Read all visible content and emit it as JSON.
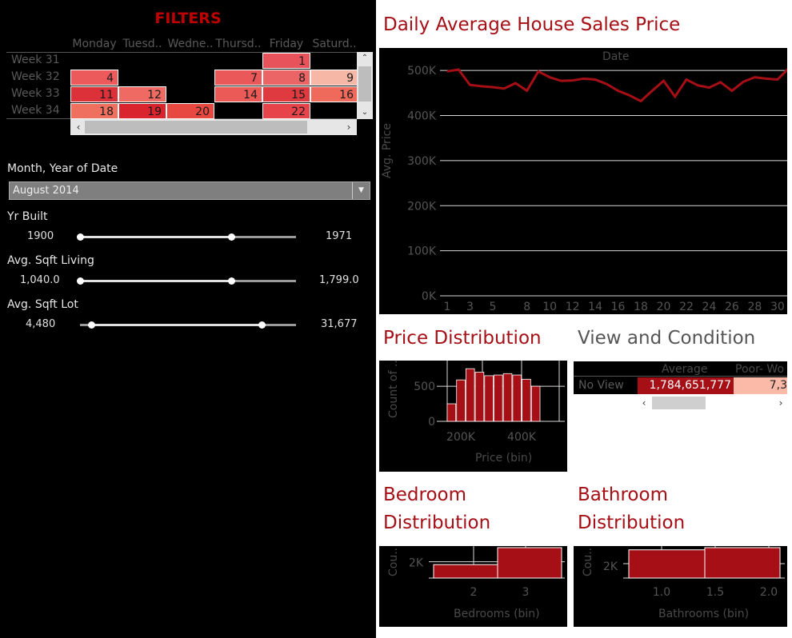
{
  "filters": {
    "title": "FILTERS",
    "calendar": {
      "days": [
        "Monday",
        "Tuesd..",
        "Wedne..",
        "Thursd..",
        "Friday",
        "Saturd.."
      ],
      "weeks": [
        "Week 31",
        "Week 32",
        "Week 33",
        "Week 34"
      ],
      "cells": [
        {
          "week": 0,
          "day": 4,
          "label": "1",
          "color": "#e8525a"
        },
        {
          "week": 1,
          "day": 0,
          "label": "4",
          "color": "#ec5a5c"
        },
        {
          "week": 1,
          "day": 3,
          "label": "7",
          "color": "#ea5859"
        },
        {
          "week": 1,
          "day": 4,
          "label": "8",
          "color": "#ec6566"
        },
        {
          "week": 1,
          "day": 5,
          "label": "9",
          "color": "#f7b7a7"
        },
        {
          "week": 2,
          "day": 0,
          "label": "11",
          "color": "#dc3139"
        },
        {
          "week": 2,
          "day": 1,
          "label": "12",
          "color": "#ee6a63"
        },
        {
          "week": 2,
          "day": 3,
          "label": "14",
          "color": "#ec5a58"
        },
        {
          "week": 2,
          "day": 4,
          "label": "15",
          "color": "#e03a41"
        },
        {
          "week": 2,
          "day": 5,
          "label": "16",
          "color": "#f06a5c"
        },
        {
          "week": 3,
          "day": 0,
          "label": "18",
          "color": "#f0705f"
        },
        {
          "week": 3,
          "day": 1,
          "label": "19",
          "color": "#d9242d"
        },
        {
          "week": 3,
          "day": 2,
          "label": "20",
          "color": "#e7483f"
        },
        {
          "week": 3,
          "day": 4,
          "label": "22",
          "color": "#e7434a"
        }
      ]
    },
    "month_year": {
      "label": "Month, Year of Date",
      "value": "August 2014"
    },
    "yr_built": {
      "label": "Yr Built",
      "min": "1900",
      "max": "1971",
      "range": [
        0,
        0.7
      ]
    },
    "sqft_living": {
      "label": "Avg. Sqft Living",
      "min": "1,040.0",
      "max": "1,799.0",
      "range": [
        0,
        0.7
      ]
    },
    "sqft_lot": {
      "label": "Avg. Sqft Lot",
      "min": "4,480",
      "max": "31,677",
      "range": [
        0.05,
        0.84
      ]
    }
  },
  "daily": {
    "title": "Daily Average House Sales Price",
    "xaxis_title": "Date",
    "yaxis_title": "Avg. Price",
    "chart_data": {
      "type": "line",
      "title": "Daily Average House Sales Price",
      "xlabel": "Date",
      "ylabel": "Avg. Price",
      "x": [
        1,
        2,
        3,
        4,
        5,
        6,
        7,
        8,
        9,
        10,
        11,
        12,
        13,
        14,
        15,
        16,
        17,
        18,
        19,
        20,
        21,
        22,
        23,
        24,
        25,
        26,
        27,
        28,
        29,
        30,
        31
      ],
      "values": [
        498000,
        502000,
        468000,
        465000,
        463000,
        460000,
        472000,
        455000,
        498000,
        485000,
        477000,
        478000,
        482000,
        480000,
        470000,
        455000,
        445000,
        432000,
        455000,
        477000,
        442000,
        480000,
        467000,
        462000,
        474000,
        455000,
        475000,
        485000,
        482000,
        480000,
        505000
      ],
      "ylim": [
        0,
        550000
      ],
      "yticks": [
        "0K",
        "100K",
        "200K",
        "300K",
        "400K",
        "500K"
      ],
      "xticks": [
        "1",
        "3",
        "5",
        "8",
        "10",
        "12",
        "14",
        "16",
        "18",
        "20",
        "22",
        "24",
        "26",
        "28",
        "30"
      ],
      "color": "#a50f15"
    }
  },
  "price_dist": {
    "title": "Price Distribution",
    "xlabel": "Price (bin)",
    "ylabel": "Count of ..",
    "chart_data": {
      "type": "bar",
      "xlabel": "Price (bin)",
      "ylabel": "Count of ..",
      "values": [
        250,
        590,
        750,
        700,
        650,
        660,
        680,
        660,
        600,
        500
      ],
      "ylim": [
        0,
        820
      ],
      "yticks": [
        "0",
        "500"
      ],
      "xticks": [
        "200K",
        "400K"
      ],
      "color": "#a50f15"
    }
  },
  "view_condition": {
    "title": "View and Condition",
    "col_headers": [
      "Average",
      "Poor- Wo"
    ],
    "row_label": "No View",
    "values": [
      "1,784,651,777",
      "7,3"
    ],
    "colors": [
      "#a50f15",
      "#fbb9a7"
    ]
  },
  "bedroom": {
    "title_line1": "Bedroom",
    "title_line2": "Distribution",
    "xlabel": "Bedrooms (bin)",
    "ylabel": "Cou..",
    "chart_data": {
      "type": "bar",
      "xlabel": "Bedrooms (bin)",
      "ylabel": "Cou..",
      "categories": [
        "2",
        "3"
      ],
      "values": [
        1500,
        3400
      ],
      "yticks": [
        "2K"
      ],
      "color": "#a50f15"
    }
  },
  "bathroom": {
    "title_line1": "Bathroom",
    "title_line2": "Distribution",
    "xlabel": "Bathrooms (bin)",
    "ylabel": "Cou..",
    "chart_data": {
      "type": "bar",
      "xlabel": "Bathrooms (bin)",
      "ylabel": "Cou..",
      "categories": [
        "1.0",
        "1.5",
        "2.0"
      ],
      "values": [
        2600,
        2800
      ],
      "yticks": [
        "2K"
      ],
      "color": "#a50f15"
    }
  }
}
